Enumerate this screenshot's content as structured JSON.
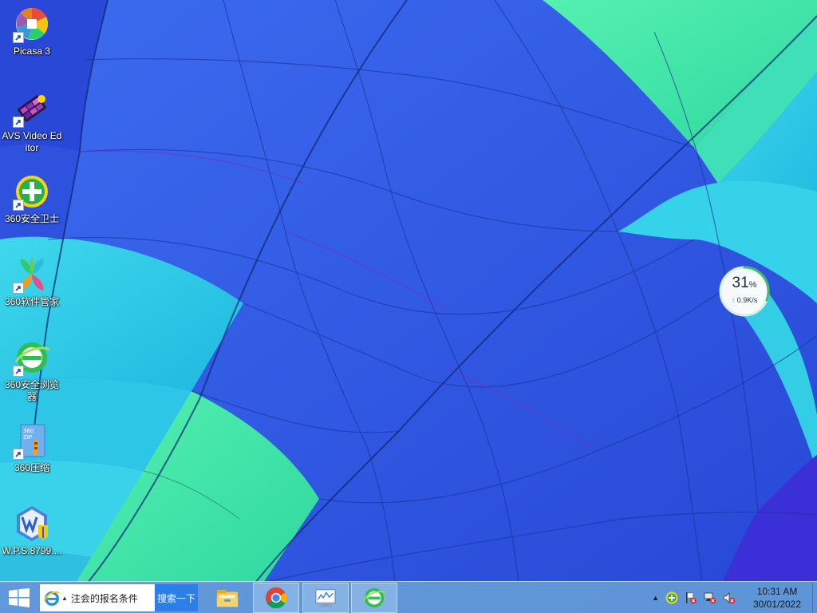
{
  "desktop": {
    "icons": [
      {
        "label": "Picasa 3",
        "icon": "picasa-icon"
      },
      {
        "label": "AVS Video Editor",
        "icon": "avs-video-editor-icon"
      },
      {
        "label": "360安全卫士",
        "icon": "360-security-guard-icon"
      },
      {
        "label": "360软件管家",
        "icon": "360-software-manager-icon"
      },
      {
        "label": "360安全浏览器",
        "icon": "360-browser-icon"
      },
      {
        "label": "360压缩",
        "icon": "360-zip-icon"
      },
      {
        "label": "W.P.S.8799....",
        "icon": "wps-office-icon"
      }
    ]
  },
  "speed_widget": {
    "percent": "31",
    "percent_unit": "%",
    "rate": "0.9K/s",
    "level": 0.31,
    "ring_color": "#3cc36a"
  },
  "taskbar": {
    "search_text": "注会的报名条件",
    "search_button": "搜索一下",
    "pinned": [
      {
        "icon": "file-explorer-icon",
        "running": false
      },
      {
        "icon": "chrome-icon",
        "running": true
      },
      {
        "icon": "resource-monitor-icon",
        "running": true
      },
      {
        "icon": "360-browser-icon",
        "running": true
      }
    ],
    "tray": {
      "chevron": "▲",
      "icons": [
        "360-guard-tray-icon",
        "action-center-flag-icon",
        "network-disconnected-icon",
        "volume-muted-icon"
      ]
    },
    "clock": {
      "time": "10:31 AM",
      "date": "30/01/2022"
    }
  },
  "colors": {
    "taskbar": "#6eaad7",
    "search_button": "#2d7fe8",
    "wallpaper_blue": "#2f5be2",
    "wallpaper_cyan": "#2fd7e8",
    "wallpaper_green": "#3fe6a0"
  }
}
